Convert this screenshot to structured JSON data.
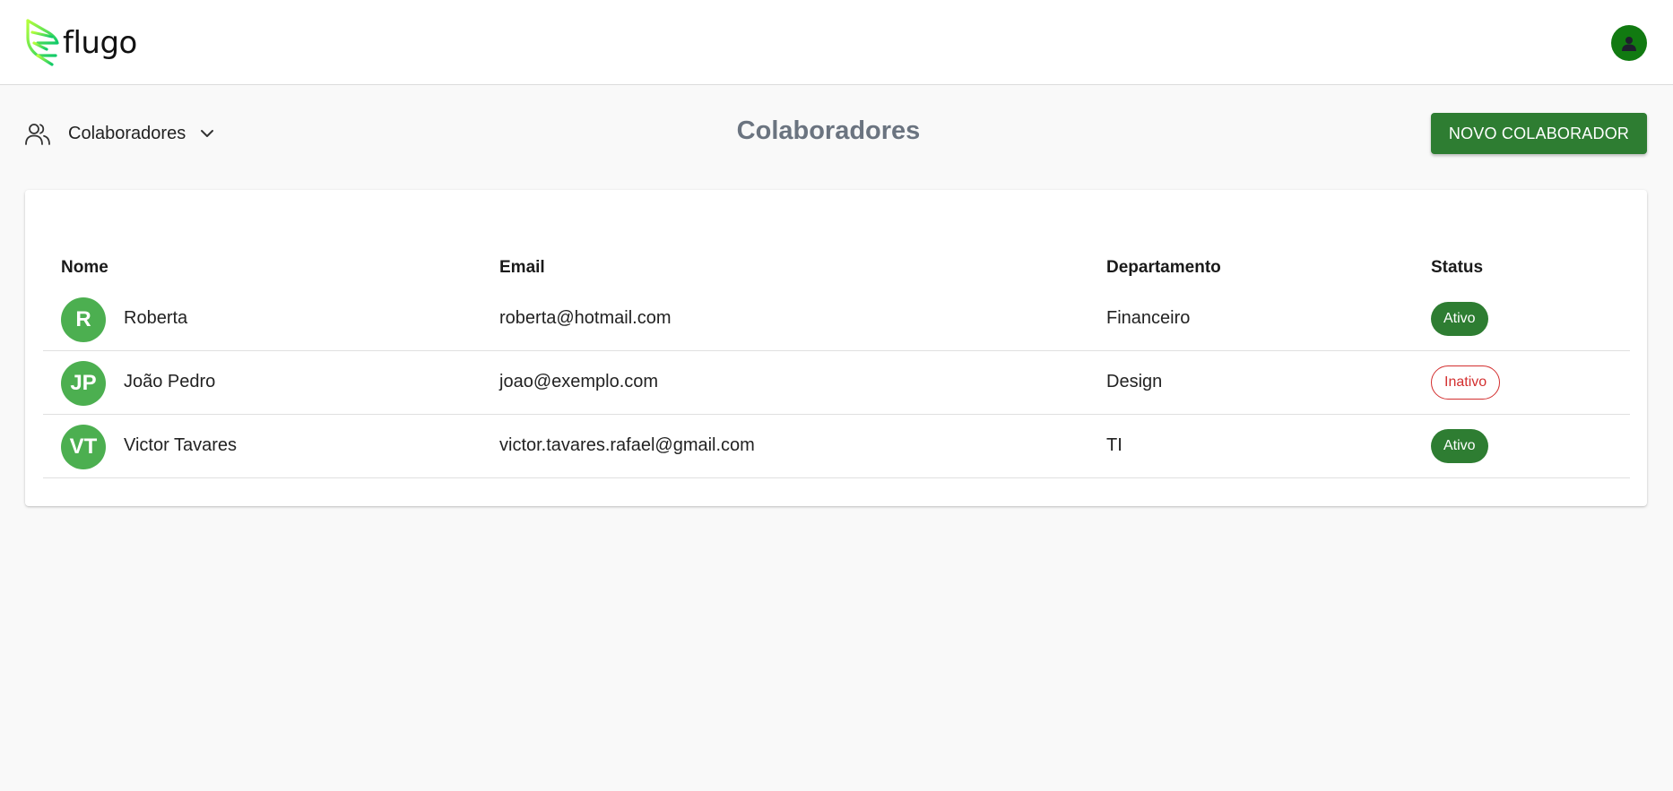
{
  "header": {
    "brand": "flugo",
    "brand_color": "#22c55e",
    "avatar_icon": "user-icon"
  },
  "nav": {
    "section_label": "Colaboradores",
    "icon": "users-icon",
    "chevron": "chevron-down-icon"
  },
  "page": {
    "title": "Colaboradores",
    "new_button_label": "NOVO COLABORADOR"
  },
  "table": {
    "columns": [
      "Nome",
      "Email",
      "Departamento",
      "Status"
    ],
    "rows": [
      {
        "initials": "R",
        "name": "Roberta",
        "email": "roberta@hotmail.com",
        "department": "Financeiro",
        "status": "Ativo",
        "status_kind": "active"
      },
      {
        "initials": "JP",
        "name": "João Pedro",
        "email": "joao@exemplo.com",
        "department": "Design",
        "status": "Inativo",
        "status_kind": "inactive"
      },
      {
        "initials": "VT",
        "name": "Victor Tavares",
        "email": "victor.tavares.rafael@gmail.com",
        "department": "TI",
        "status": "Ativo",
        "status_kind": "active"
      }
    ]
  },
  "colors": {
    "primary": "#2e7d32",
    "avatar": "#4caf50",
    "inactive": "#d32f2f",
    "title": "#6b7480"
  }
}
